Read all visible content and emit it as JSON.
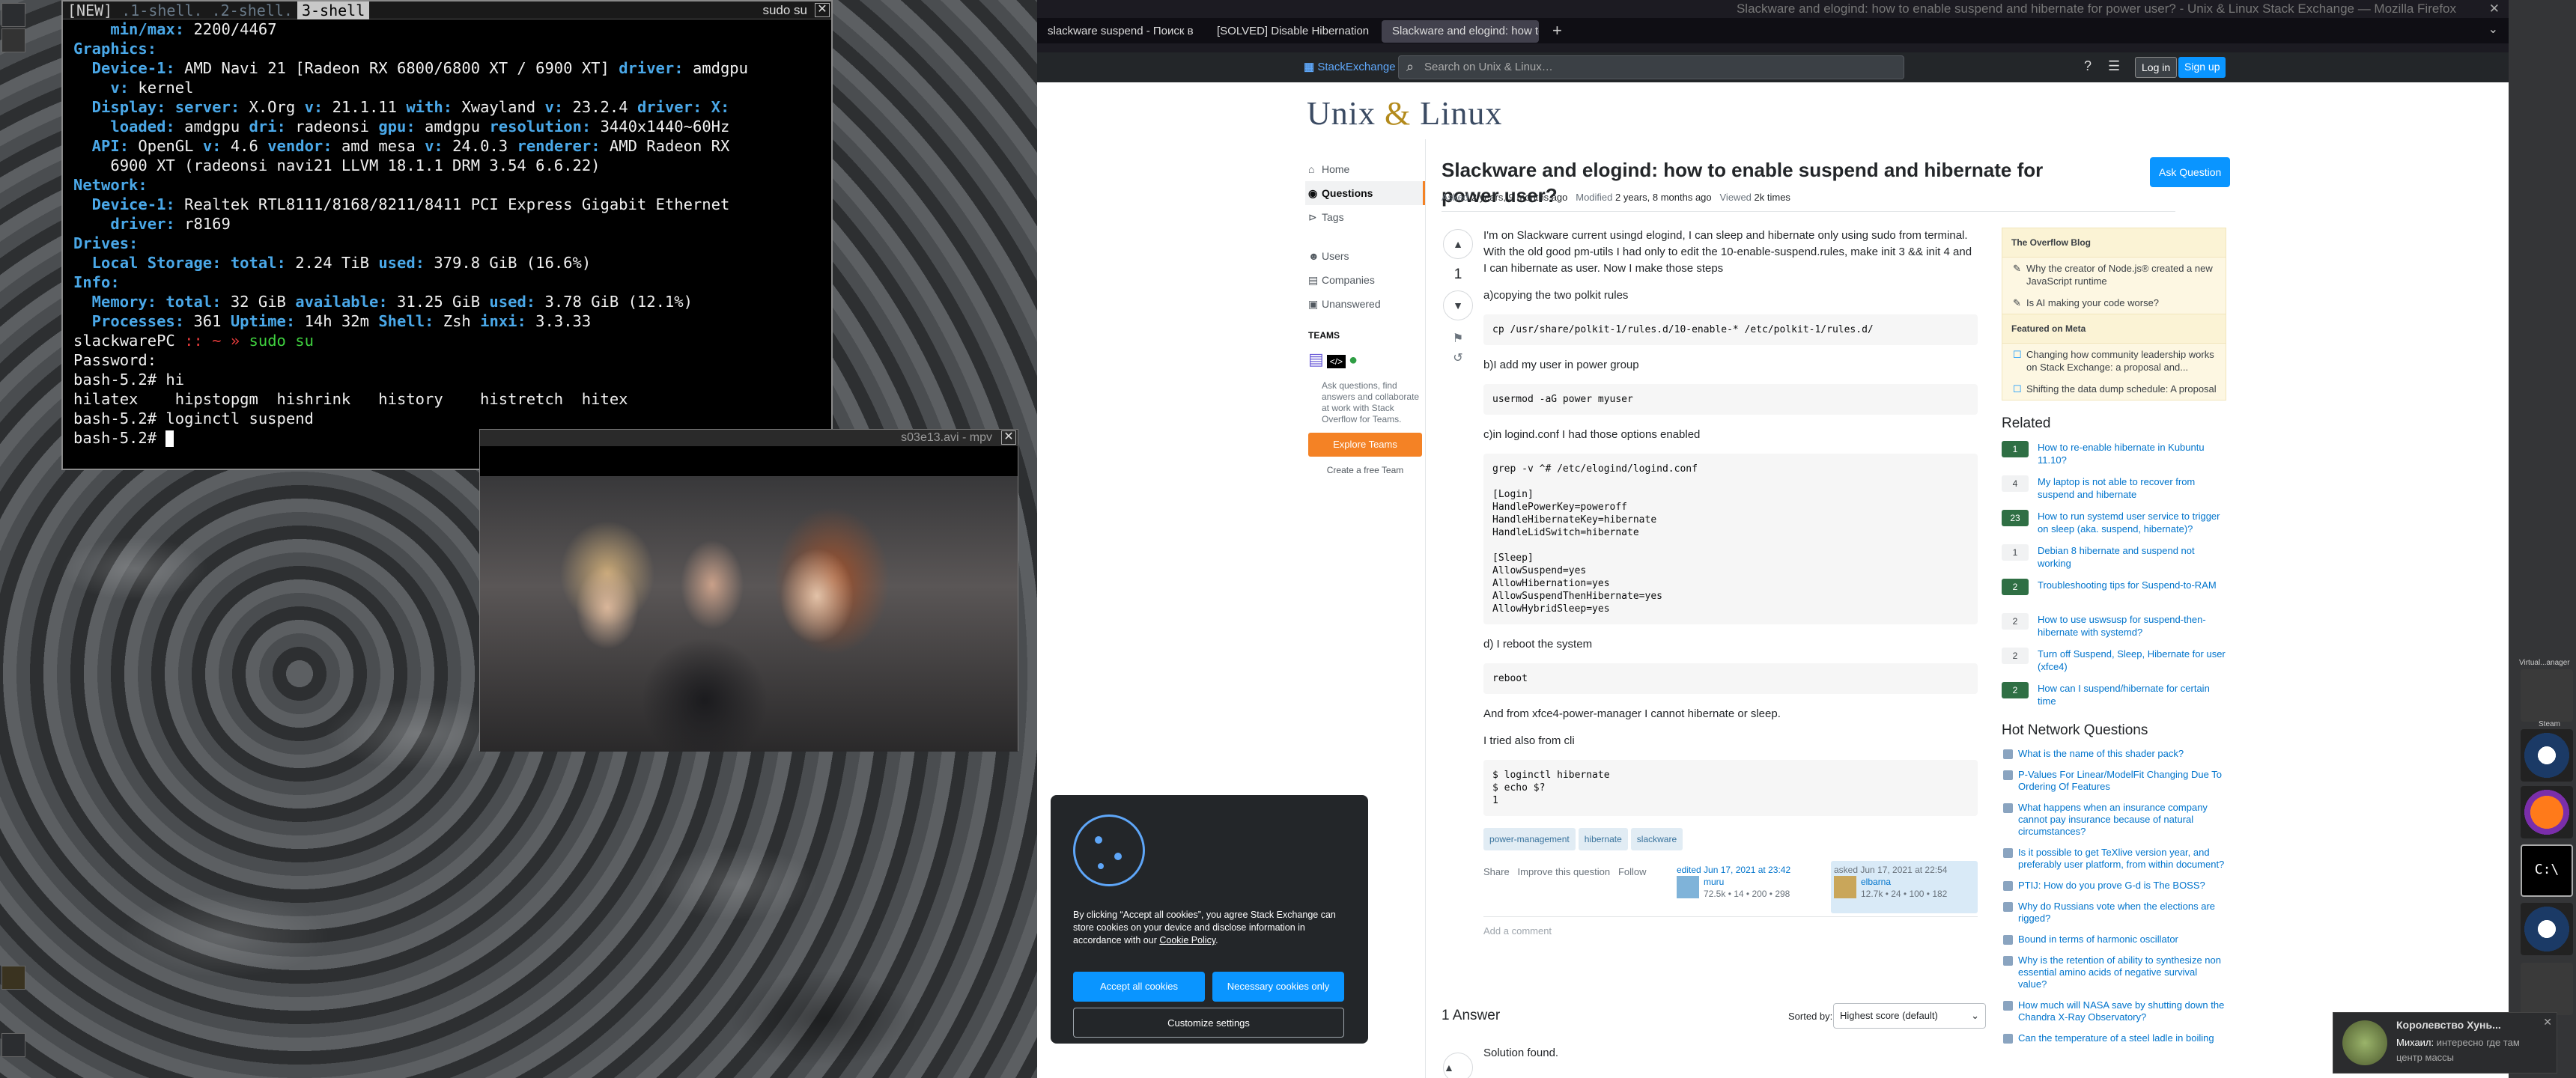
{
  "terminal": {
    "tabs": [
      "[NEW]",
      ".1-shell.",
      ".2-shell.",
      "3-shell"
    ],
    "title": "sudo su",
    "lines": [
      {
        "k": "    min/max: ",
        "v": "2200/4467"
      },
      {
        "k": "Graphics:",
        "v": ""
      },
      {
        "k": "  Device-1: ",
        "v": "AMD Navi 21 [Radeon RX 6800/6800 XT / 6900 XT] ",
        "k2": "driver: ",
        "v2": "amdgpu"
      },
      {
        "k": "    v: ",
        "v": "kernel"
      },
      {
        "k": "  Display: server: ",
        "v": "X.Org ",
        "k2": "v: ",
        "v2": "21.1.11 ",
        "k3": "with: ",
        "v3": "Xwayland ",
        "k4": "v: ",
        "v4": "23.2.4 ",
        "k5": "driver: X:"
      },
      {
        "k": "    loaded: ",
        "v": "amdgpu ",
        "k2": "dri: ",
        "v2": "radeonsi ",
        "k3": "gpu: ",
        "v3": "amdgpu ",
        "k4": "resolution: ",
        "v4": "3440x1440~60Hz"
      },
      {
        "k": "  API: ",
        "v": "OpenGL ",
        "k2": "v: ",
        "v2": "4.6 ",
        "k3": "vendor: ",
        "v3": "amd mesa ",
        "k4": "v: ",
        "v4": "24.0.3 ",
        "k5": "renderer: ",
        "v5": "AMD Radeon RX"
      },
      {
        "k": "    ",
        "v": "6900 XT (radeonsi navi21 LLVM 18.1.1 DRM 3.54 6.6.22)"
      },
      {
        "k": "Network:",
        "v": ""
      },
      {
        "k": "  Device-1: ",
        "v": "Realtek RTL8111/8168/8211/8411 PCI Express Gigabit Ethernet"
      },
      {
        "k": "    driver: ",
        "v": "r8169"
      },
      {
        "k": "Drives:",
        "v": ""
      },
      {
        "k": "  Local Storage: total: ",
        "v": "2.24 TiB ",
        "k2": "used: ",
        "v2": "379.8 GiB (16.6%)"
      },
      {
        "k": "Info:",
        "v": ""
      },
      {
        "k": "  Memory: total: ",
        "v": "32 GiB ",
        "k2": "available: ",
        "v2": "31.25 GiB ",
        "k3": "used: ",
        "v3": "3.78 GiB (12.1%)"
      },
      {
        "k": "  Processes: ",
        "v": "361 ",
        "k2": "Uptime: ",
        "v2": "14h 32m ",
        "k3": "Shell: ",
        "v3": "Zsh ",
        "k4": "inxi: ",
        "v4": "3.3.33"
      }
    ],
    "prompt_host": "slackwarePC",
    "prompt_sep": " :: ~ » ",
    "prompt_cmd": "sudo su",
    "plain_lines": [
      "Password:",
      "bash-5.2# hi",
      "hilatex    hipstopgm  hishrink   history    histretch  hitex",
      "bash-5.2# loginctl suspend",
      "bash-5.2# "
    ]
  },
  "mpv": {
    "title": "s03e13.avi - mpv"
  },
  "firefox": {
    "window_title": "Slackware and elogind: how to enable suspend and hibernate for power user? - Unix & Linux Stack Exchange — Mozilla Firefox",
    "tabs": [
      "slackware suspend - Поиск в Go",
      "[SOLVED] Disable Hibernation and",
      "Slackware and elogind: how to e"
    ],
    "topbar": {
      "logo_a": "Stack",
      "logo_b": "Exchange",
      "search_placeholder": "Search on Unix & Linux…",
      "login": "Log in",
      "signup": "Sign up"
    },
    "site_logo_a": "Unix",
    "site_logo_amp": " & ",
    "site_logo_b": "Linux",
    "nav": {
      "home": "Home",
      "questions": "Questions",
      "tags": "Tags",
      "users": "Users",
      "companies": "Companies",
      "unanswered": "Unanswered",
      "teams": "TEAMS",
      "teams_text": "Ask questions, find answers and collaborate at work with Stack Overflow for Teams.",
      "explore": "Explore Teams",
      "free": "Create a free Team"
    },
    "question": {
      "title": "Slackware and elogind: how to enable suspend and hibernate for power user?",
      "ask_button": "Ask Question",
      "asked_label": "Asked",
      "asked": "2 years, 9 months ago",
      "modified_label": "Modified",
      "modified": "2 years, 8 months ago",
      "viewed_label": "Viewed",
      "viewed": "2k times",
      "votes": "1",
      "p1": "I'm on Slackware current usingd elogind, I can sleep and hibernate only using sudo from terminal. With the old good pm-utils I had only to edit the 10-enable-suspend.rules, make init 3 && init 4 and I can hibernate as user. Now I make those steps",
      "p2": "a)copying the two polkit rules",
      "code1": "cp /usr/share/polkit-1/rules.d/10-enable-* /etc/polkit-1/rules.d/",
      "p3": "b)I add my user in power group",
      "code2": "usermod -aG power myuser",
      "p4": "c)in logind.conf I had those options enabled",
      "code3": "grep -v ^# /etc/elogind/logind.conf\n\n[Login]\nHandlePowerKey=poweroff\nHandleHibernateKey=hibernate\nHandleLidSwitch=hibernate\n\n[Sleep]\nAllowSuspend=yes\nAllowHibernation=yes\nAllowSuspendThenHibernate=yes\nAllowHybridSleep=yes",
      "p5": "d) I reboot the system",
      "code4": "reboot",
      "p6": "And from xfce4-power-manager I cannot hibernate or sleep.",
      "p7": "I tried also from cli",
      "code5": "$ loginctl hibernate\n$ echo $?\n1",
      "tags": [
        "power-management",
        "hibernate",
        "slackware"
      ],
      "share": "Share",
      "improve": "Improve this question",
      "follow": "Follow",
      "edited": "edited Jun 17, 2021 at 23:42",
      "editor": "muru",
      "editor_rep": "72.5k • 14 • 200 • 298",
      "asked_card": "asked Jun 17, 2021 at 22:54",
      "asker": "elbarna",
      "asker_rep": "12.7k • 24 • 100 • 182",
      "add_comment": "Add a comment",
      "answers_count": "1 Answer",
      "sorted_by": "Sorted by:",
      "sort_value": "Highest score (default)",
      "answer_start": "Solution found."
    },
    "sidebar": {
      "blog_title": "The Overflow Blog",
      "blog": [
        "Why the creator of Node.js® created a new JavaScript runtime",
        "Is AI making your code worse?"
      ],
      "meta_title": "Featured on Meta",
      "meta": [
        "Changing how community leadership works on Stack Exchange: a proposal and...",
        "Shifting the data dump schedule: A proposal"
      ],
      "related_title": "Related",
      "related": [
        {
          "n": "1",
          "ok": true,
          "t": "How to re-enable hibernate in Kubuntu 11.10?"
        },
        {
          "n": "4",
          "ok": false,
          "t": "My laptop is not able to recover from suspend and hibernate"
        },
        {
          "n": "23",
          "ok": true,
          "t": "How to run systemd user service to trigger on sleep (aka. suspend, hibernate)?"
        },
        {
          "n": "1",
          "ok": false,
          "t": "Debian 8 hibernate and suspend not working"
        },
        {
          "n": "2",
          "ok": true,
          "t": "Troubleshooting tips for Suspend-to-RAM"
        },
        {
          "n": "2",
          "ok": false,
          "t": "How to use uswsusp for suspend-then-hibernate with systemd?"
        },
        {
          "n": "2",
          "ok": false,
          "t": "Turn off Suspend, Sleep, Hibernate for user (xfce4)"
        },
        {
          "n": "2",
          "ok": true,
          "t": "How can I suspend/hibernate for certain time"
        }
      ],
      "hnq_title": "Hot Network Questions",
      "hnq": [
        "What is the name of this shader pack?",
        "P-Values For Linear/ModelFit Changing Due To Ordering Of Features",
        "What happens when an insurance company cannot pay insurance because of natural circumstances?",
        "Is it possible to get TeXlive version year, and preferably user platform, from within document?",
        "PTIJ: How do you prove G-d is The BOSS?",
        "Why do Russians vote when the elections are rigged?",
        "Bound in terms of harmonic oscillator",
        "Why is the retention of ability to synthesize non essential amino acids of negative survival value?",
        "How much will NASA save by shutting down the Chandra X-Ray Observatory?",
        "Can the temperature of a steel ladle in boiling"
      ]
    },
    "cookie": {
      "text": "By clicking “Accept all cookies”, you agree Stack Exchange can store cookies on your device and disclose information in accordance with our",
      "link": "Cookie Policy",
      "accept": "Accept all cookies",
      "necessary": "Necessary cookies only",
      "customize": "Customize settings"
    }
  },
  "dock": {
    "label1": "Virtual...anager",
    "label2": "Steam"
  },
  "notification": {
    "title": "Королевство Хунь...",
    "sender": "Михаил:",
    "body": "интересно где там",
    "body2": "центр массы"
  }
}
